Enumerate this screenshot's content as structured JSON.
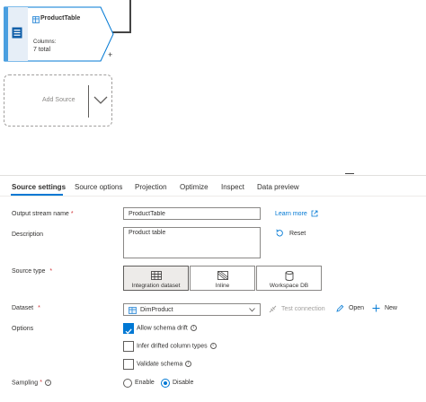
{
  "node": {
    "title": "ProductTable",
    "columns_label": "Columns:",
    "columns_value": "7 total",
    "add_symbol": "+"
  },
  "add_source": {
    "label": "Add Source"
  },
  "tabs": [
    {
      "label": "Source settings",
      "active": true
    },
    {
      "label": "Source options"
    },
    {
      "label": "Projection"
    },
    {
      "label": "Optimize"
    },
    {
      "label": "Inspect"
    },
    {
      "label": "Data preview"
    }
  ],
  "form": {
    "output_stream": {
      "label": "Output stream name",
      "required": "*",
      "value": "ProductTable"
    },
    "learn_more": "Learn more",
    "description": {
      "label": "Description",
      "value": "Product table"
    },
    "reset": "Reset",
    "source_type": {
      "label": "Source type",
      "required": "*",
      "options": [
        "Integration dataset",
        "Inline",
        "Workspace DB"
      ],
      "selected": "Integration dataset"
    },
    "dataset": {
      "label": "Dataset",
      "required": "*",
      "value": "DimProduct",
      "test_connection": "Test connection",
      "open": "Open",
      "new": "New"
    },
    "options": {
      "label": "Options",
      "allow_schema_drift": "Allow schema drift",
      "infer_drifted": "Infer drifted column types",
      "validate_schema": "Validate schema"
    },
    "sampling": {
      "label": "Sampling",
      "required": "*",
      "enable": "Enable",
      "disable": "Disable",
      "selected": "Disable"
    }
  },
  "colors": {
    "accent": "#0078d4",
    "required": "#d13438",
    "node_accent": "#4a9fe0"
  }
}
